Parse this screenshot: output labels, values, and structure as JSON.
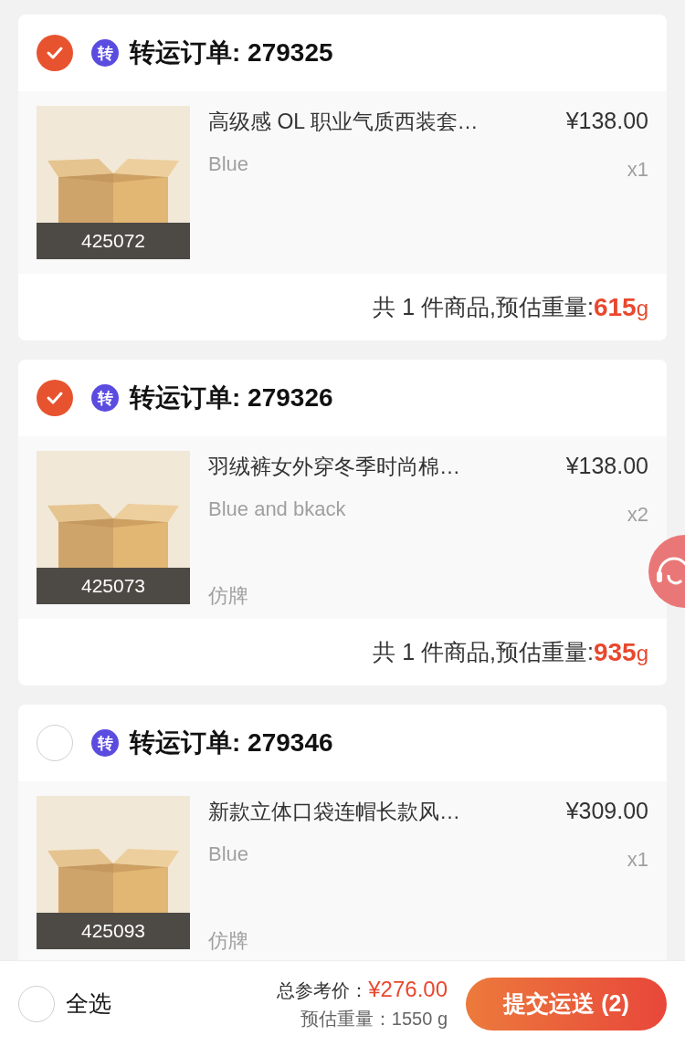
{
  "orders": [
    {
      "selected": true,
      "badge": "转",
      "title": "转运订单: 279325",
      "items": [
        {
          "code": "425072",
          "name": "高级感 OL 职业气质西装套…",
          "price": "¥138.00",
          "variant": "Blue",
          "quantity": "x1"
        }
      ],
      "summary": {
        "text": "共 1 件商品,预估重量:",
        "weight": "615",
        "unit": "g"
      }
    },
    {
      "selected": true,
      "badge": "转",
      "title": "转运订单: 279326",
      "items": [
        {
          "code": "425073",
          "name": "羽绒裤女外穿冬季时尚棉…",
          "price": "¥138.00",
          "variant": "Blue and bkack",
          "quantity": "x2",
          "tag": "仿牌"
        }
      ],
      "summary": {
        "text": "共 1 件商品,预估重量:",
        "weight": "935",
        "unit": "g"
      }
    },
    {
      "selected": false,
      "badge": "转",
      "title": "转运订单: 279346",
      "items": [
        {
          "code": "425093",
          "name": "新款立体口袋连帽长款风…",
          "price": "¥309.00",
          "variant": "Blue",
          "quantity": "x1",
          "tag": "仿牌"
        }
      ]
    }
  ],
  "bottom_bar": {
    "select_all": {
      "label": "全选",
      "selected": false
    },
    "total_label": "总参考价：",
    "total": "¥276.00",
    "weight_label": "预估重量：1550 g",
    "submit": "提交运送 (2)"
  }
}
